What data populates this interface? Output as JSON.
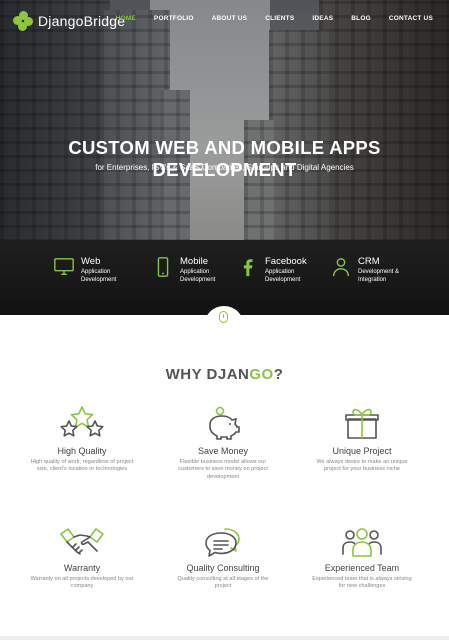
{
  "brand": {
    "logo_text": "DjangoBridge",
    "accent": "#8cc63f"
  },
  "nav": {
    "items": [
      {
        "label": "HOME",
        "active": true
      },
      {
        "label": "PORTFOLIO"
      },
      {
        "label": "ABOUT US"
      },
      {
        "label": "CLIENTS"
      },
      {
        "label": "IDEAS"
      },
      {
        "label": "BLOG"
      },
      {
        "label": "CONTACT US"
      }
    ]
  },
  "hero": {
    "title": "CUSTOM WEB AND MOBILE APPS DEVELOPMENT",
    "subtitle": "for Enterprises, ISV's & SaaS Companies, Start-ups and Digital Agencies"
  },
  "services": [
    {
      "title": "Web",
      "desc1": "Application",
      "desc2": "Development",
      "icon": "monitor-icon"
    },
    {
      "title": "Mobile",
      "desc1": "Application",
      "desc2": "Development",
      "icon": "phone-icon"
    },
    {
      "title": "Facebook",
      "desc1": "Application",
      "desc2": "Development",
      "icon": "facebook-icon"
    },
    {
      "title": "CRM",
      "desc1": "Development &",
      "desc2": "Integration",
      "icon": "person-icon"
    }
  ],
  "why": {
    "title_main": "WHY DJAN",
    "title_accent": "GO",
    "title_end": "?"
  },
  "features": [
    {
      "title": "High Quality",
      "desc": "High quality of work, regardless of project size, client's location or technologies",
      "icon": "stars-icon"
    },
    {
      "title": "Save Money",
      "desc": "Flexible business model allows our customers to save money on project development",
      "icon": "piggy-bank-icon"
    },
    {
      "title": "Unique Project",
      "desc": "We always desire to make an unique project for your business niche",
      "icon": "gift-icon"
    },
    {
      "title": "Warranty",
      "desc": "Warranty on all projects developed by our company",
      "icon": "handshake-icon"
    },
    {
      "title": "Quality Consulting",
      "desc": "Quality consulting at all stages of the project",
      "icon": "chat-bubbles-icon"
    },
    {
      "title": "Experienced Team",
      "desc": "Experienced team that is always striving for new challenges",
      "icon": "team-icon"
    }
  ]
}
